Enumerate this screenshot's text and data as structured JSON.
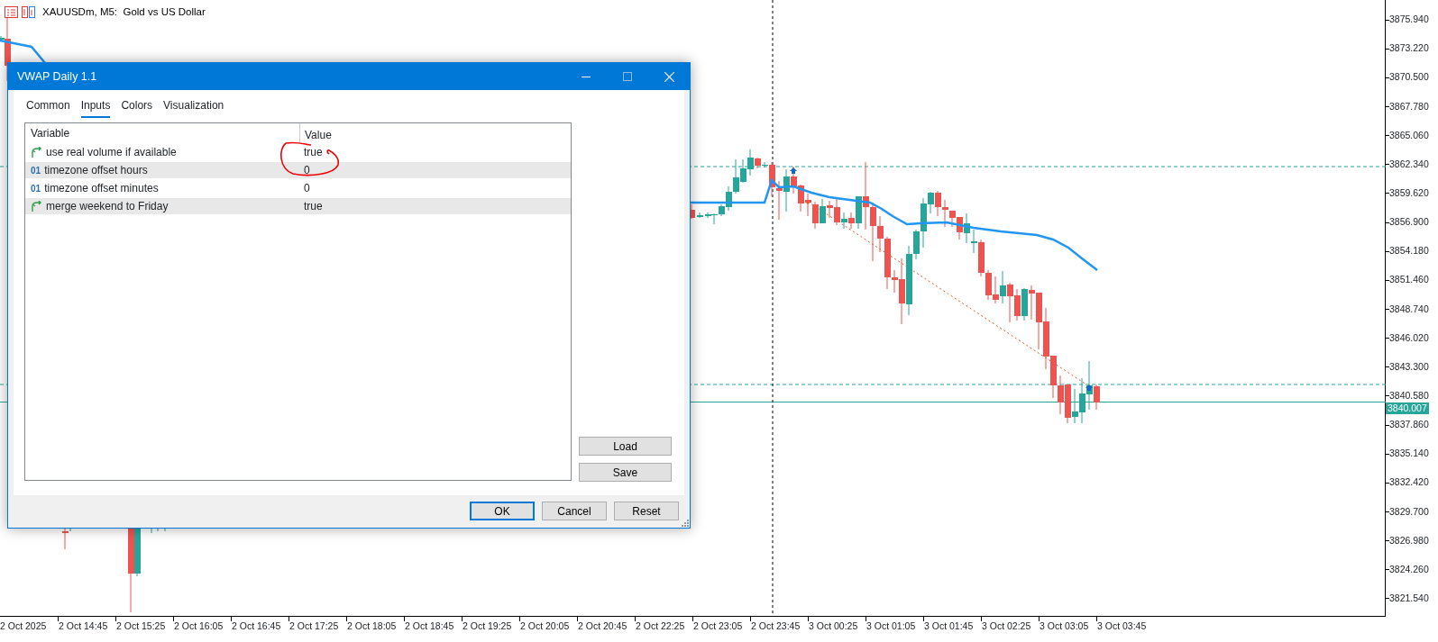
{
  "chart": {
    "title": "XAUUSDm, M5:  Gold vs US Dollar",
    "price_labels": [
      "3875.940",
      "3873.220",
      "3870.500",
      "3867.780",
      "3865.060",
      "3862.340",
      "3859.620",
      "3856.900",
      "3854.180",
      "3851.460",
      "3848.740",
      "3846.020",
      "3843.300",
      "3840.580",
      "3837.860",
      "3835.140",
      "3832.420",
      "3829.700",
      "3826.980",
      "3824.260",
      "3821.540"
    ],
    "current_price": "3840.007",
    "time_labels": [
      "2 Oct 2025",
      "2 Oct 14:45",
      "2 Oct 15:25",
      "2 Oct 16:05",
      "2 Oct 16:45",
      "2 Oct 17:25",
      "2 Oct 18:05",
      "2 Oct 18:45",
      "2 Oct 19:25",
      "2 Oct 20:05",
      "2 Oct 20:45",
      "2 Oct 22:25",
      "2 Oct 23:05",
      "2 Oct 23:45",
      "3 Oct 00:25",
      "3 Oct 01:05",
      "3 Oct 01:45",
      "3 Oct 02:25",
      "3 Oct 03:05",
      "3 Oct 03:45"
    ]
  },
  "dialog": {
    "title": "VWAP Daily 1.1",
    "tabs": [
      {
        "label": "Common",
        "selected": false
      },
      {
        "label": "Inputs",
        "selected": true
      },
      {
        "label": "Colors",
        "selected": false
      },
      {
        "label": "Visualization",
        "selected": false
      }
    ],
    "table": {
      "columns": [
        "Variable",
        "Value"
      ],
      "rows": [
        {
          "kind": "bool",
          "name": "use real volume if available",
          "value": "true"
        },
        {
          "kind": "int",
          "type_mark": "01",
          "name": "timezone offset hours",
          "value": "0"
        },
        {
          "kind": "int",
          "type_mark": "01",
          "name": "timezone offset minutes",
          "value": "0"
        },
        {
          "kind": "bool",
          "name": "merge weekend to Friday",
          "value": "true"
        }
      ]
    },
    "side_buttons": [
      "Load",
      "Save"
    ],
    "buttons": [
      {
        "label": "OK",
        "default": true
      },
      {
        "label": "Cancel",
        "default": false
      },
      {
        "label": "Reset",
        "default": false
      }
    ]
  }
}
